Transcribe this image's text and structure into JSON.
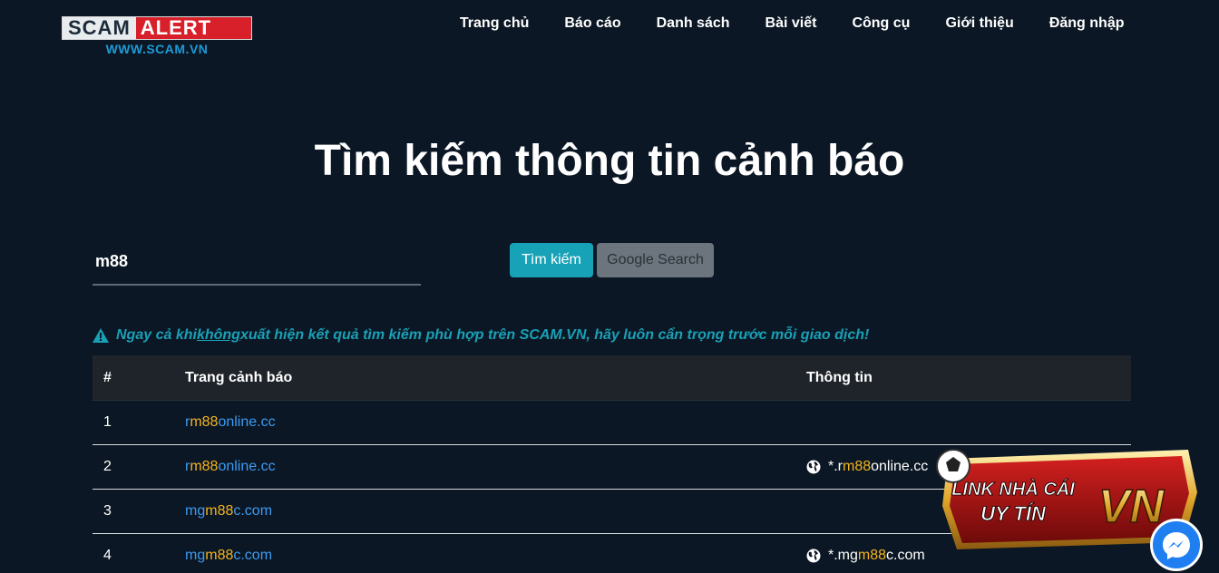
{
  "logo": {
    "scam": "SCAM",
    "alert": "ALERT",
    "url": "WWW.SCAM.VN"
  },
  "nav": [
    {
      "label": "Trang chủ"
    },
    {
      "label": "Báo cáo"
    },
    {
      "label": "Danh sách"
    },
    {
      "label": "Bài viết"
    },
    {
      "label": "Công cụ"
    },
    {
      "label": "Giới thiệu"
    },
    {
      "label": "Đăng nhập"
    }
  ],
  "title": "Tìm kiếm thông tin cảnh báo",
  "search": {
    "value": "m88",
    "submit_label": "Tìm kiếm",
    "google_label": "Google Search"
  },
  "warning": {
    "before": "Ngay cả khi ",
    "emphasis": "không",
    "after": " xuất hiện kết quả tìm kiếm phù hợp trên SCAM.VN, hãy luôn cẩn trọng trước mỗi giao dịch!"
  },
  "table": {
    "headers": [
      "#",
      "Trang cảnh báo",
      "Thông tin"
    ],
    "rows": [
      {
        "num": "1",
        "site": [
          "r",
          "m88",
          "online.cc"
        ],
        "info": null
      },
      {
        "num": "2",
        "site": [
          "r",
          "m88",
          "online.cc"
        ],
        "info": [
          "*.r",
          "m88",
          "online.cc"
        ]
      },
      {
        "num": "3",
        "site": [
          "mg",
          "m88",
          "c.com"
        ],
        "info": null
      },
      {
        "num": "4",
        "site": [
          "mg",
          "m88",
          "c.com"
        ],
        "info": [
          "*.mg",
          "m88",
          "c.com"
        ]
      }
    ]
  },
  "ad": {
    "line1": "LINK NHÀ CÁI",
    "line2": "UY TÍN",
    "badge": "VN"
  },
  "colors": {
    "background": "#0b1724",
    "accent": "#17a2b8",
    "link": "#3e9bf3",
    "highlight": "#f5b31e",
    "logo_red": "#d8202a"
  }
}
